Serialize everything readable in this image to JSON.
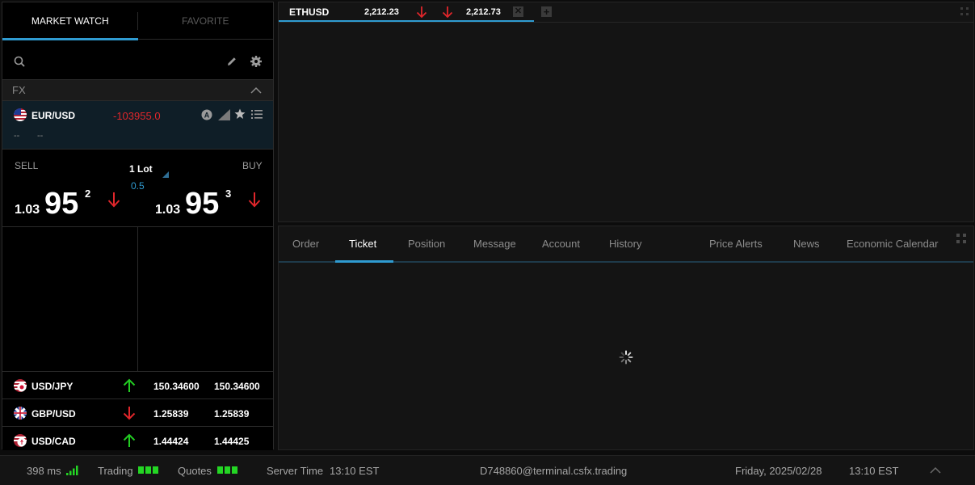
{
  "colors": {
    "accent": "#2f9bd1",
    "down": "#e0262b",
    "up": "#22cc22",
    "status_ok": "#24d624",
    "panel_bg": "#141414"
  },
  "market_watch": {
    "tabs": [
      {
        "label": "MARKET WATCH",
        "active": true
      },
      {
        "label": "FAVORITE",
        "active": false
      }
    ],
    "search": {
      "placeholder": "",
      "icons": [
        "search-icon",
        "pencil-icon",
        "gear-icon"
      ]
    },
    "group": {
      "label": "FX",
      "icon": "chevron-up-icon"
    },
    "selected": {
      "symbol": "EUR/USD",
      "change": "-103955.0",
      "dash1": "--",
      "dash2": "--",
      "icons": [
        "auto-icon",
        "signal-bars-icon",
        "star-icon",
        "list-icon"
      ]
    },
    "trade": {
      "sell_label": "SELL",
      "buy_label": "BUY",
      "lot": "1 Lot",
      "spread": "0.5",
      "sell": {
        "prefix": "1.03",
        "pips": "95",
        "fraction": "2",
        "direction": "down"
      },
      "buy": {
        "prefix": "1.03",
        "pips": "95",
        "fraction": "3",
        "direction": "down"
      }
    },
    "quotes": [
      {
        "symbol": "USD/JPY",
        "direction": "up",
        "bid": "150.34600",
        "ask": "150.34600"
      },
      {
        "symbol": "GBP/USD",
        "direction": "down",
        "bid": "1.25839",
        "ask": "1.25839"
      },
      {
        "symbol": "USD/CAD",
        "direction": "up",
        "bid": "1.44424",
        "ask": "1.44425"
      }
    ]
  },
  "chart_tab": {
    "symbol": "ETHUSD",
    "bid": "2,212.23",
    "ask": "2,212.73",
    "close_icon": "close-icon",
    "add_icon": "plus-icon"
  },
  "bottom_tabs": [
    {
      "label": "Order",
      "active": false
    },
    {
      "label": "Ticket",
      "active": true
    },
    {
      "label": "Position",
      "active": false
    },
    {
      "label": "Message",
      "active": false
    },
    {
      "label": "Account",
      "active": false
    },
    {
      "label": "History",
      "active": false
    },
    {
      "label": "Price Alerts",
      "active": false
    },
    {
      "label": "News",
      "active": false
    },
    {
      "label": "Economic Calendar",
      "active": false
    }
  ],
  "status_bar": {
    "latency": "398 ms",
    "trading_label": "Trading",
    "quotes_label": "Quotes",
    "server_time_label": "Server Time",
    "server_time": "13:10 EST",
    "user": "D748860@terminal.csfx.trading",
    "date": "Friday, 2025/02/28",
    "local_time": "13:10 EST"
  }
}
